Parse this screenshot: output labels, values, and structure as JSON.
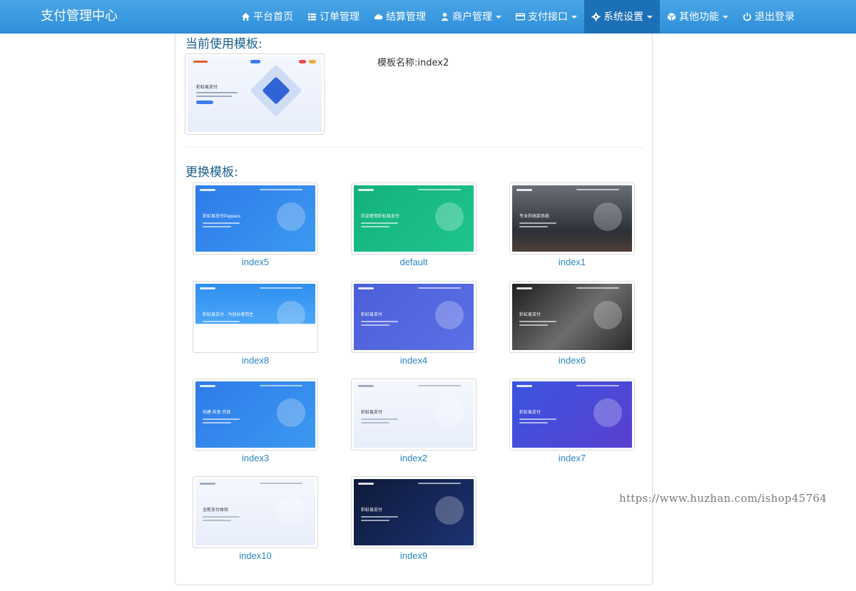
{
  "navbar": {
    "brand": "支付管理中心",
    "items": [
      {
        "label": "平台首页",
        "icon": "home-icon",
        "dropdown": false
      },
      {
        "label": "订单管理",
        "icon": "list-icon",
        "dropdown": false
      },
      {
        "label": "结算管理",
        "icon": "cloud-icon",
        "dropdown": false
      },
      {
        "label": "商户管理",
        "icon": "user-icon",
        "dropdown": true
      },
      {
        "label": "支付接口",
        "icon": "credit-card-icon",
        "dropdown": true
      },
      {
        "label": "系统设置",
        "icon": "gear-icon",
        "dropdown": true,
        "active": true
      },
      {
        "label": "其他功能",
        "icon": "cube-icon",
        "dropdown": true
      },
      {
        "label": "退出登录",
        "icon": "power-icon",
        "dropdown": false
      }
    ]
  },
  "current": {
    "title": "当前使用模板:",
    "name_label": "模板名称:index2",
    "thumb_caption": "彩虹易支付"
  },
  "change": {
    "title": "更换模板:",
    "templates": [
      {
        "name": "index5",
        "skin": "sk-blue",
        "headline": "彩虹易支付Paypass"
      },
      {
        "name": "default",
        "skin": "sk-green",
        "headline": "欢迎使用彩虹易支付"
      },
      {
        "name": "index1",
        "skin": "sk-city",
        "headline": "专业的收款系统"
      },
      {
        "name": "index8",
        "skin": "sk-wave",
        "headline": "彩虹易支付 · 为创业者而生"
      },
      {
        "name": "index4",
        "skin": "sk-indigo",
        "headline": "彩虹易支付"
      },
      {
        "name": "index6",
        "skin": "sk-bw",
        "headline": "彩虹易支付"
      },
      {
        "name": "index3",
        "skin": "sk-blue",
        "headline": "共建 共享 开放"
      },
      {
        "name": "index2",
        "skin": "sk-light",
        "headline": "彩虹易支付"
      },
      {
        "name": "index7",
        "skin": "sk-purpleblue",
        "headline": "彩虹易支付"
      },
      {
        "name": "index10",
        "skin": "sk-light",
        "headline": "全新支付体验"
      },
      {
        "name": "index9",
        "skin": "sk-dark",
        "headline": "彩虹易支付"
      }
    ]
  },
  "watermark": "https://www.huzhan.com/ishop45764"
}
